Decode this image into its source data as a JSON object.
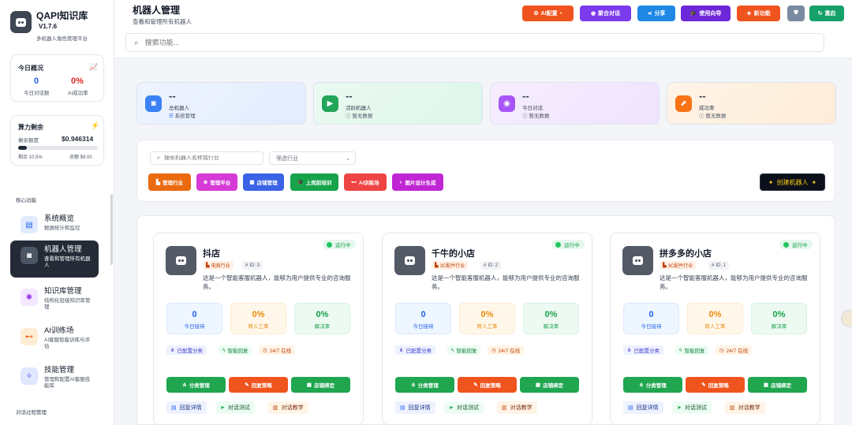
{
  "app": {
    "title": "QAPI知识库",
    "version": "V1.7.6",
    "subtitle": "多机器人角色管理平台"
  },
  "today": {
    "title": "今日概况",
    "conversations_value": "0",
    "conversations_label": "今日对话数",
    "ai_rate_value": "0%",
    "ai_rate_label": "AI成功率"
  },
  "compute": {
    "title": "算力剩余",
    "quota_label": "剩余额度",
    "quota_value": "$0.946314",
    "remain_label": "剩余 10.5%",
    "total_label": "总额 $9.00",
    "remain_fraction": 0.105
  },
  "sidebar": {
    "section_core": "核心功能",
    "section_dialog": "对话过程管理",
    "items": [
      {
        "title": "系统概览",
        "desc": "数据统计和监控",
        "icon": "chart-icon"
      },
      {
        "title": "机器人管理",
        "desc": "查看和管理所有机器人",
        "icon": "robot-icon"
      },
      {
        "title": "知识库管理",
        "desc": "结构化层级知识库管理",
        "icon": "brain-icon"
      },
      {
        "title": "AI训练场",
        "desc": "AI客服智能训练与评估",
        "icon": "dumbbell-icon"
      },
      {
        "title": "技能管理",
        "desc": "管理和配置AI客服技能库",
        "icon": "wand-icon"
      }
    ]
  },
  "header": {
    "title": "机器人管理",
    "subtitle": "查看和管理所有机器人",
    "search_placeholder": "搜索功能...",
    "buttons": [
      "AI配置",
      "聚合对话",
      "分享",
      "使用向导",
      "新功能",
      "重启"
    ],
    "button_colors": [
      "#f0541e",
      "#7c3aed",
      "#1e88e5",
      "#6d28d9",
      "#f0541e",
      "#7b8aa0",
      "#16a06a"
    ]
  },
  "stats": [
    {
      "value": "--",
      "label": "总机器人",
      "sub": "系统管理"
    },
    {
      "value": "--",
      "label": "活跃机器人",
      "sub": "暂无数据"
    },
    {
      "value": "--",
      "label": "今日对话",
      "sub": "暂无数据"
    },
    {
      "value": "--",
      "label": "成功率",
      "sub": "暂无数据"
    }
  ],
  "filters": {
    "search_placeholder": "搜索机器人名称或行业",
    "industry_placeholder": "筛选行业",
    "tags": [
      "管理行业",
      "管理平台",
      "店铺管理",
      "上岗前培训",
      "AI训练场",
      "图片设计生成"
    ],
    "tag_colors": [
      "#ea6a10",
      "#d63bd6",
      "#3b63e6",
      "#16a34a",
      "#ef4444",
      "#c026d3"
    ],
    "create_label": "创建机器人"
  },
  "bots": [
    {
      "name": "抖店",
      "industry": "电商行业",
      "id": "ID: 3",
      "status": "运行中",
      "desc": "这是一个智能客服机器人，能够为用户提供专业的咨询服务。"
    },
    {
      "name": "千牛的小店",
      "industry": "3C配件行业",
      "id": "ID: 2",
      "status": "运行中",
      "desc": "这是一个智能客服机器人，能够为用户提供专业的咨询服务。"
    },
    {
      "name": "拼多多的小店",
      "industry": "3C配件行业",
      "id": "ID: 1",
      "status": "运行中",
      "desc": "这是一个智能客服机器人，能够为用户提供专业的咨询服务。"
    }
  ],
  "bot_common": {
    "metrics": [
      {
        "value": "0",
        "label": "今日接待"
      },
      {
        "value": "0%",
        "label": "转人工率"
      },
      {
        "value": "0%",
        "label": "解决率"
      }
    ],
    "features": [
      "已配置分类",
      "智能回复",
      "24/7 在线"
    ],
    "actions": [
      "分类管理",
      "回复策略",
      "店铺绑定"
    ],
    "links": [
      "回复详情",
      "对话测试",
      "对话教学"
    ]
  }
}
